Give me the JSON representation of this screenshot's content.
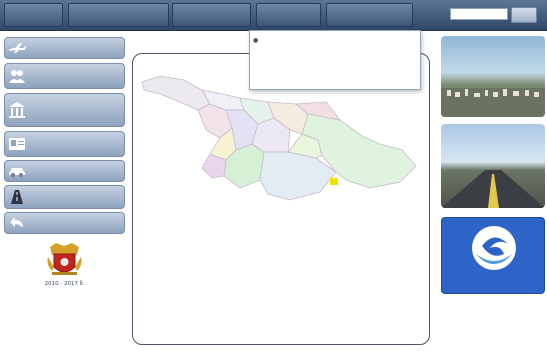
{
  "top_nav": [
    {
      "name": "nav-item-1",
      "label": ""
    },
    {
      "name": "nav-item-2",
      "label": ""
    },
    {
      "name": "nav-item-3",
      "label": ""
    },
    {
      "name": "nav-item-4",
      "label": ""
    },
    {
      "name": "nav-item-5",
      "label": ""
    }
  ],
  "search": {
    "placeholder": "",
    "button_label": ""
  },
  "sidebar": {
    "items": [
      {
        "label": "",
        "icon": "plane-icon"
      },
      {
        "label": "",
        "icon": "people-icon"
      },
      {
        "label": "",
        "icon": "building-icon"
      },
      {
        "label": "",
        "icon": "document-icon"
      },
      {
        "label": "",
        "icon": "car-icon"
      },
      {
        "label": "",
        "icon": "road-icon"
      },
      {
        "label": "",
        "icon": "back-arrow-icon"
      }
    ],
    "crest_caption": [
      "",
      "2010 - 2017 წ.",
      ""
    ]
  },
  "breadcrumb": "",
  "dropdown": {
    "items": [
      "",
      "",
      ""
    ]
  },
  "map": {
    "highlight_color": "#f2e100"
  },
  "banners": [
    {
      "name": "banner-regional-development",
      "title_line1": "",
      "title_line2": ""
    },
    {
      "name": "banner-road-department",
      "title_line1": "",
      "title_line2": ""
    },
    {
      "name": "banner-water-supply",
      "caption": ""
    }
  ],
  "colors": {
    "top_bar": "#3d5779",
    "sidebar_button": "#9aaec8",
    "panel_border": "#4a5568"
  }
}
